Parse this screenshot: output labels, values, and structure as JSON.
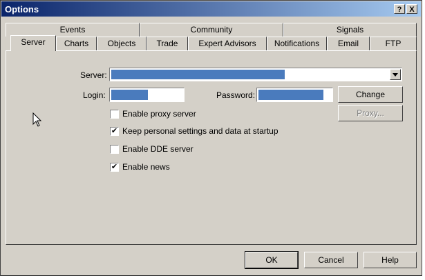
{
  "window": {
    "title": "Options",
    "help_label": "?",
    "close_label": "X"
  },
  "tabs_row1": [
    "Events",
    "Community",
    "Signals"
  ],
  "tabs_row2": [
    "Server",
    "Charts",
    "Objects",
    "Trade",
    "Expert Advisors",
    "Notifications",
    "Email",
    "FTP"
  ],
  "active_tab": "Server",
  "server": {
    "server_label": "Server:",
    "login_label": "Login:",
    "password_label": "Password:",
    "change_label": "Change",
    "proxy_label": "Proxy..."
  },
  "checkboxes": [
    {
      "label": "Enable proxy server",
      "checked": false
    },
    {
      "label": "Keep personal settings and data at startup",
      "checked": true
    },
    {
      "label": "Enable DDE server",
      "checked": false
    },
    {
      "label": "Enable news",
      "checked": true
    }
  ],
  "check_glyph": "✔",
  "footer": {
    "ok_label": "OK",
    "cancel_label": "Cancel",
    "help_label": "Help"
  },
  "colors": {
    "title_start": "#0a246a",
    "title_end": "#a6caf0",
    "selection": "#4a7bbd",
    "face": "#d4d0c8"
  }
}
